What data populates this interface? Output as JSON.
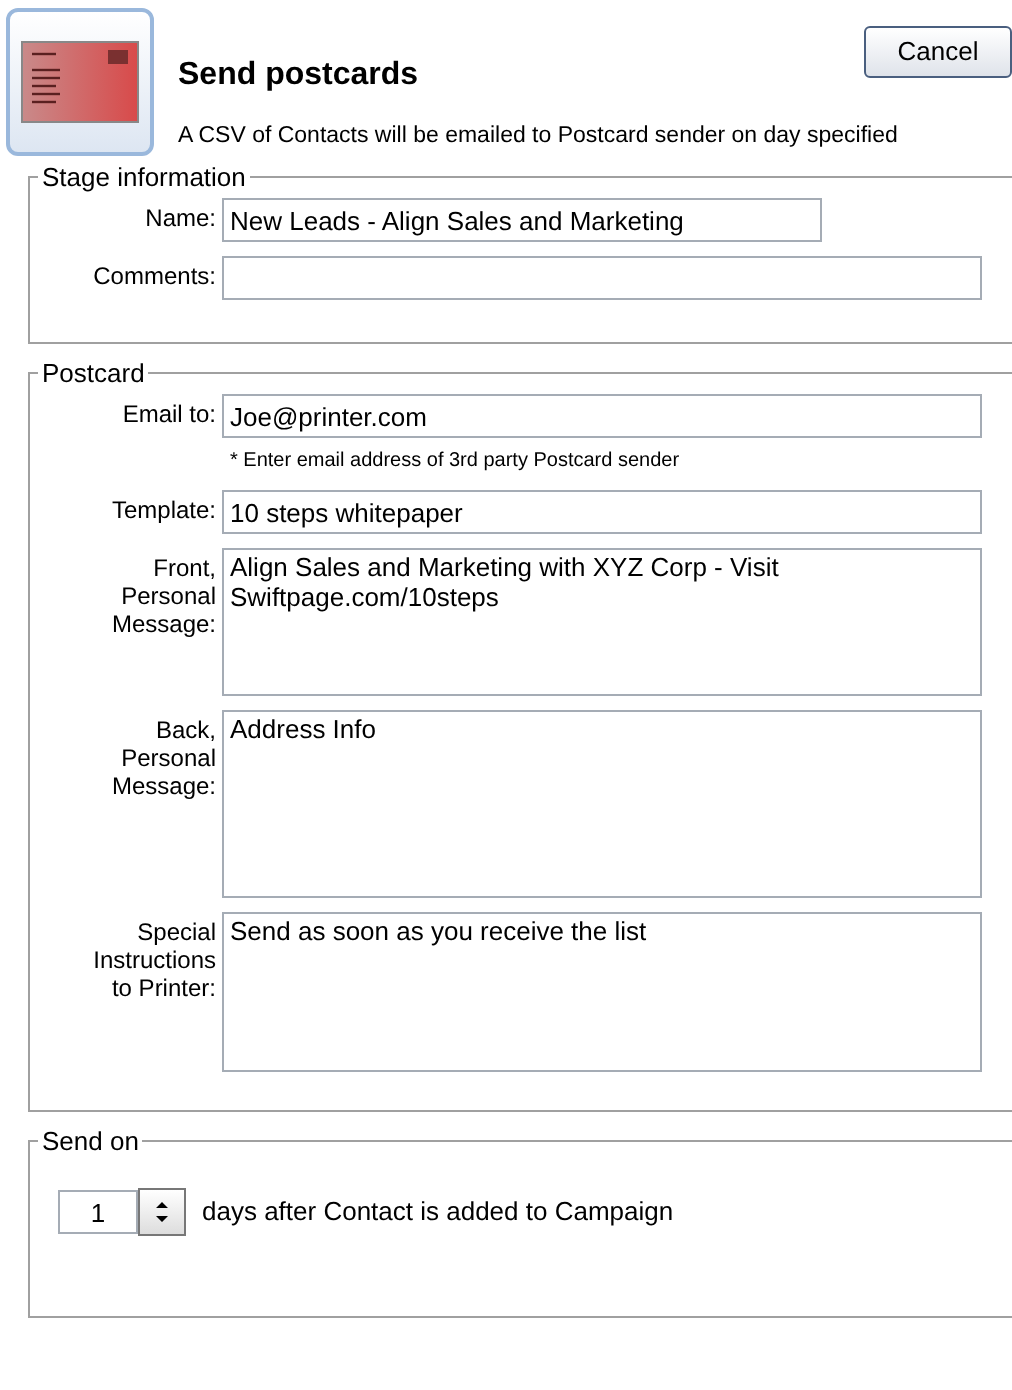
{
  "header": {
    "title": "Send postcards",
    "subtitle": "A CSV of Contacts will be emailed to Postcard sender on day specified",
    "cancel_button": "Cancel"
  },
  "stage_information": {
    "legend": "Stage information",
    "fields": [
      {
        "label": "Name:",
        "value": "New Leads - Align Sales and Marketing",
        "kind": "short"
      },
      {
        "label": "Comments:",
        "kind": "long"
      }
    ]
  },
  "postcard": {
    "legend": "Postcard",
    "fields": [
      {
        "label": "Email to:",
        "value": "Joe@printer.com",
        "kind": "line",
        "note": "* Enter email address of 3rd party Postcard sender"
      },
      {
        "label": "Template:",
        "value": "10 steps whitepaper",
        "kind": "line"
      },
      {
        "label": "Front, Personal Message:",
        "value": "Align Sales and Marketing with XYZ Corp - Visit Swiftpage.com/10steps",
        "kind": "small-area"
      },
      {
        "label": "Back, Personal Message:",
        "value": "Address Info",
        "kind": "area"
      },
      {
        "label": "Special Instructions to Printer:",
        "value": "Send as soon as you receive the list",
        "kind": "small-area"
      }
    ]
  },
  "send_on": {
    "legend": "Send on",
    "value": "1",
    "text": "days after Contact is added to Campaign"
  }
}
